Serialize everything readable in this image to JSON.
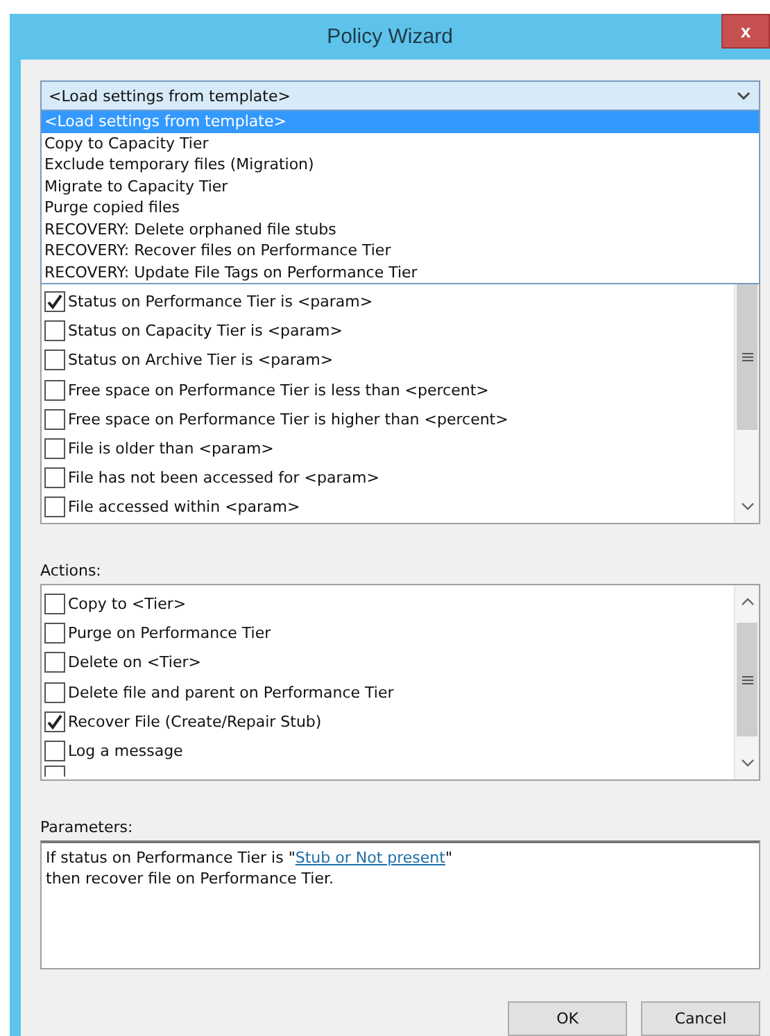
{
  "window": {
    "title": "Policy Wizard",
    "close": "x"
  },
  "template_dropdown": {
    "value": "<Load settings from template>",
    "expanded": true,
    "options": [
      {
        "label": "<Load settings from template>",
        "selected": true
      },
      {
        "label": "Copy to Capacity Tier",
        "selected": false
      },
      {
        "label": "Exclude temporary files (Migration)",
        "selected": false
      },
      {
        "label": "Migrate to Capacity Tier",
        "selected": false
      },
      {
        "label": "Purge copied files",
        "selected": false
      },
      {
        "label": "RECOVERY: Delete orphaned file stubs",
        "selected": false
      },
      {
        "label": "RECOVERY: Recover files on Performance Tier",
        "selected": false
      },
      {
        "label": "RECOVERY: Update File Tags on Performance Tier",
        "selected": false
      }
    ]
  },
  "conditions": {
    "items": [
      {
        "label": "Status on Performance Tier is <param>",
        "checked": true
      },
      {
        "label": "Status on Capacity Tier is <param>",
        "checked": false
      },
      {
        "label": "Status on Archive Tier is <param>",
        "checked": false
      },
      {
        "label": "Free space on Performance Tier is less than <percent>",
        "checked": false
      },
      {
        "label": "Free space on Performance Tier is higher than <percent>",
        "checked": false
      },
      {
        "label": "File is older than <param>",
        "checked": false
      },
      {
        "label": "File has not been accessed for <param>",
        "checked": false
      },
      {
        "label": "File accessed within <param>",
        "checked": false
      }
    ]
  },
  "actions": {
    "label": "Actions:",
    "items": [
      {
        "label": "Copy to <Tier>",
        "checked": false
      },
      {
        "label": "Purge on Performance Tier",
        "checked": false
      },
      {
        "label": "Delete on <Tier>",
        "checked": false
      },
      {
        "label": "Delete file and parent on Performance Tier",
        "checked": false
      },
      {
        "label": "Recover File (Create/Repair Stub)",
        "checked": true
      },
      {
        "label": "Log a message",
        "checked": false
      }
    ]
  },
  "parameters": {
    "label": "Parameters:",
    "text_before": "If status on Performance Tier is \"",
    "link": "Stub or Not present",
    "text_after": "\"",
    "line_2": "then recover file on Performance Tier."
  },
  "buttons": [
    "OK",
    "Cancel"
  ]
}
